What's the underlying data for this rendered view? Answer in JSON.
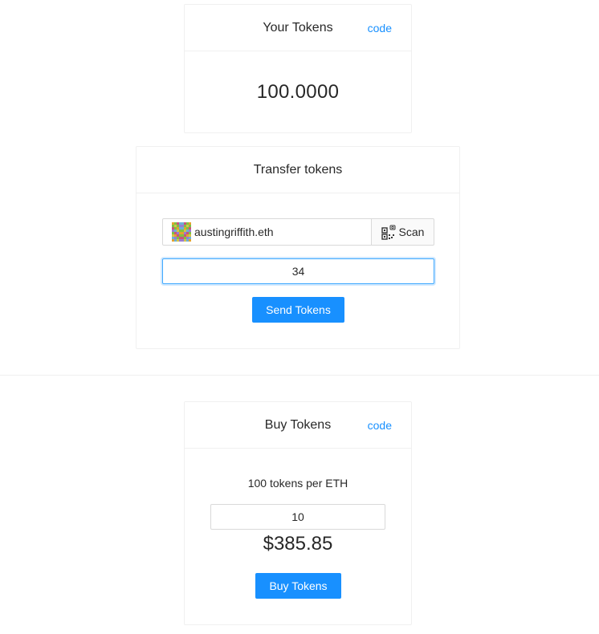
{
  "balance_card": {
    "title": "Your Tokens",
    "code_link": "code",
    "balance": "100.0000"
  },
  "transfer_card": {
    "title": "Transfer tokens",
    "address_value": "austingriffith.eth",
    "scan_label": "Scan",
    "amount_value": "34",
    "send_label": "Send Tokens"
  },
  "buy_card": {
    "title": "Buy Tokens",
    "code_link": "code",
    "rate_text": "100 tokens per ETH",
    "eth_value": "10",
    "price_text": "$385.85",
    "buy_label": "Buy Tokens"
  },
  "icons": {
    "blockie": "blockie-avatar-icon",
    "scan": "qr-scan-icon"
  },
  "colors": {
    "primary": "#1890ff",
    "border": "#f0f0f0"
  }
}
